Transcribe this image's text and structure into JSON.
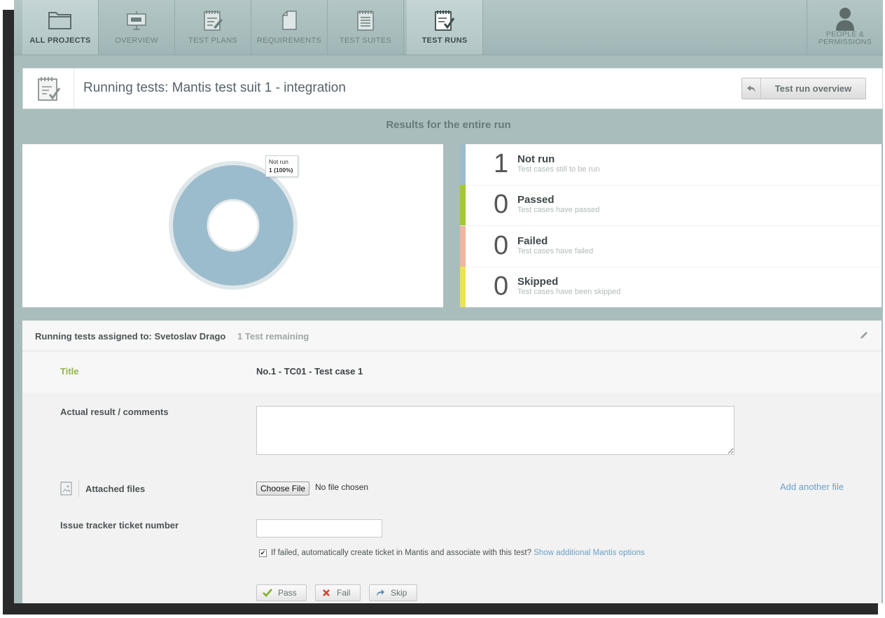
{
  "nav": {
    "tabs": [
      {
        "label": "ALL PROJECTS",
        "icon": "folder-icon"
      },
      {
        "label": "OVERVIEW",
        "icon": "presentation-board-icon"
      },
      {
        "label": "TEST PLANS",
        "icon": "notepad-pencil-icon"
      },
      {
        "label": "REQUIREMENTS",
        "icon": "document-icon"
      },
      {
        "label": "TEST SUITES",
        "icon": "notepad-list-icon"
      },
      {
        "label": "TEST RUNS",
        "icon": "notepad-check-icon"
      }
    ],
    "people_label_line1": "PEOPLE &",
    "people_label_line2": "PERMISSIONS",
    "active_tab": "TEST RUNS"
  },
  "header": {
    "title": "Running tests: Mantis test suit 1 - integration",
    "overview_button": "Test run overview"
  },
  "results_title": "Results for the entire run",
  "chart_data": {
    "type": "pie",
    "variant": "donut",
    "slices": [
      {
        "label": "Not run",
        "value": 1,
        "percent": 100,
        "color": "#9bbccd"
      },
      {
        "label": "Passed",
        "value": 0,
        "percent": 0,
        "color": "#a6c63a"
      },
      {
        "label": "Failed",
        "value": 0,
        "percent": 0,
        "color": "#f2b3a0"
      },
      {
        "label": "Skipped",
        "value": 0,
        "percent": 0,
        "color": "#ece15a"
      }
    ],
    "tooltip": {
      "label": "Not run",
      "value_text": "1 (100%)"
    }
  },
  "stats": [
    {
      "count": "1",
      "name": "Not run",
      "desc": "Test cases still to be run",
      "color": "#9bbccd"
    },
    {
      "count": "0",
      "name": "Passed",
      "desc": "Test cases have passed",
      "color": "#a6c63a"
    },
    {
      "count": "0",
      "name": "Failed",
      "desc": "Test cases have failed",
      "color": "#f2b3a0"
    },
    {
      "count": "0",
      "name": "Skipped",
      "desc": "Test cases have been skipped",
      "color": "#ece15a"
    }
  ],
  "run": {
    "assigned": "Running tests assigned to: Svetoslav Drago",
    "remaining": "1 Test remaining",
    "title_label": "Title",
    "title_value": "No.1 - TC01 - Test case 1",
    "comments_label": "Actual result / comments",
    "comments_value": "",
    "attached_label": "Attached files",
    "choose_file": "Choose File",
    "no_file": "No file chosen",
    "add_file": "Add another file",
    "ticket_label": "Issue tracker ticket number",
    "ticket_value": "",
    "auto_ticket_text": "If failed, automatically create ticket in Mantis and associate with this test?",
    "auto_ticket_checked": true,
    "mantis_options_link": "Show additional Mantis options",
    "pass": "Pass",
    "fail": "Fail",
    "skip": "Skip"
  }
}
